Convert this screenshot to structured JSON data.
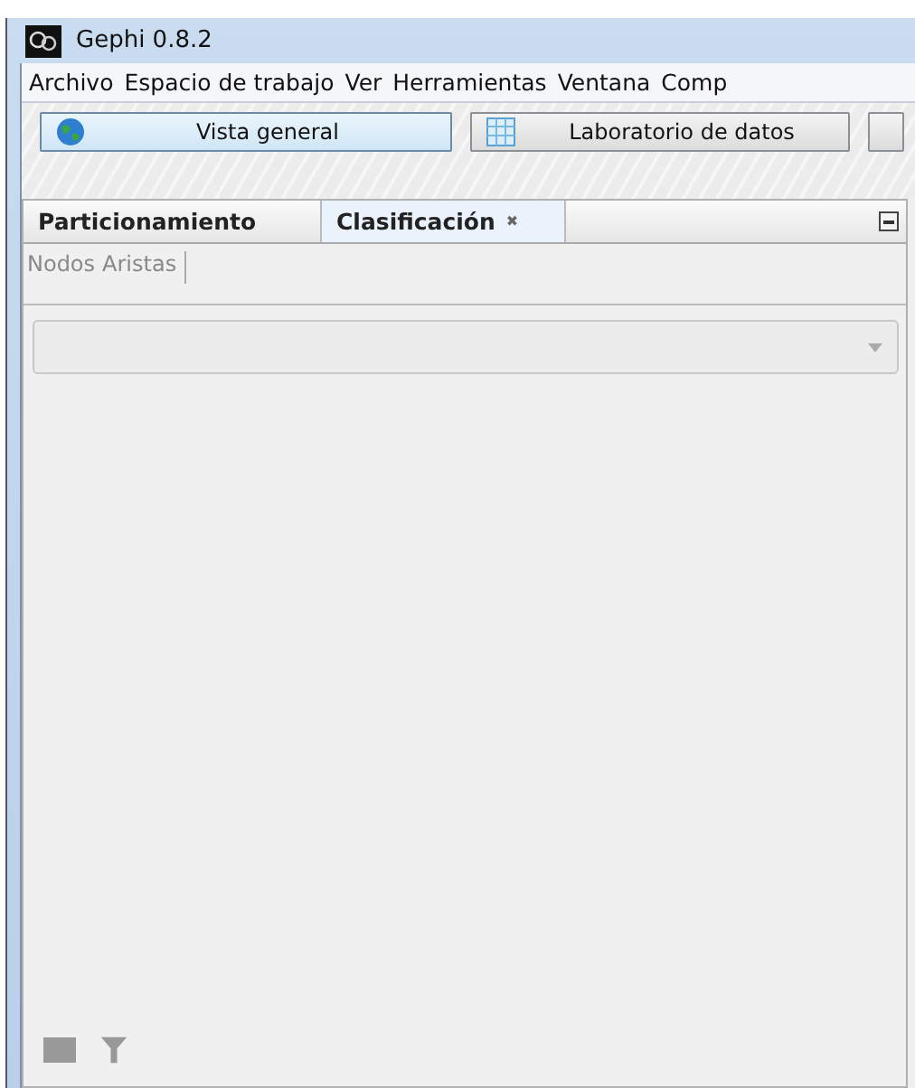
{
  "window": {
    "title": "Gephi 0.8.2"
  },
  "menu": [
    "Archivo",
    "Espacio de trabajo",
    "Ver",
    "Herramientas",
    "Ventana",
    "Comp"
  ],
  "toolbar": [
    {
      "label": "Vista general",
      "kind": "globe",
      "selected": true
    },
    {
      "label": "Laboratorio de datos",
      "kind": "table",
      "selected": false
    },
    {
      "kind": "cut",
      "selected": false
    }
  ],
  "panel_tabs": [
    {
      "label": "Particionamiento",
      "selected": false,
      "closable": false
    },
    {
      "label": "Clasificación",
      "selected": true,
      "closable": true
    }
  ],
  "close_glyph": "✖",
  "subtabs": [
    "Nodos",
    "Aristas"
  ]
}
